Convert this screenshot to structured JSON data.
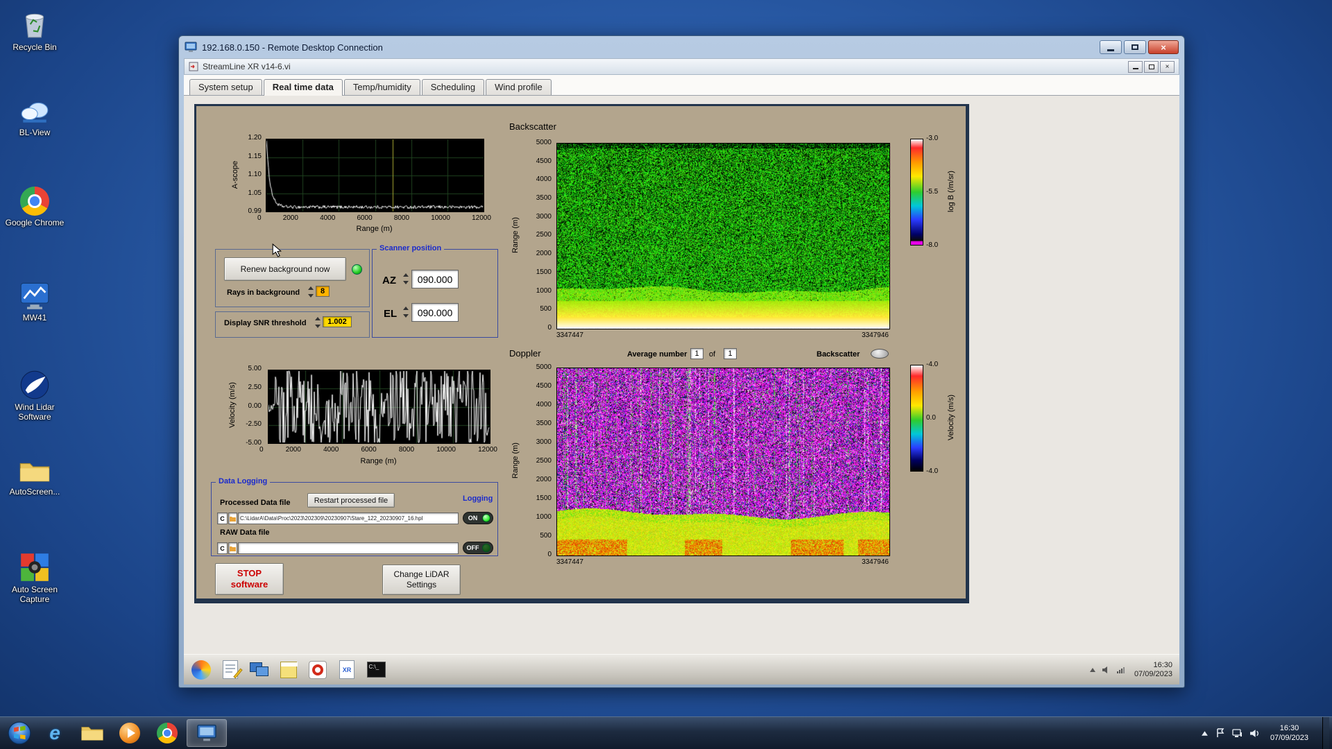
{
  "desktop": {
    "icons": [
      {
        "label": "Recycle Bin"
      },
      {
        "label": "BL-View"
      },
      {
        "label": "Google Chrome"
      },
      {
        "label": "MW41"
      },
      {
        "label": "Wind Lidar Software"
      },
      {
        "label": "AutoScreen..."
      },
      {
        "label": "Auto Screen Capture"
      }
    ]
  },
  "rdp": {
    "title": "192.168.0.150 - Remote Desktop Connection"
  },
  "vi": {
    "title": "StreamLine XR v14-6.vi",
    "tabs": [
      {
        "label": "System setup",
        "active": false
      },
      {
        "label": "Real time data",
        "active": true
      },
      {
        "label": "Temp/humidity",
        "active": false
      },
      {
        "label": "Scheduling",
        "active": false
      },
      {
        "label": "Wind profile",
        "active": false
      }
    ]
  },
  "panel": {
    "background_controls": {
      "renew_button": "Renew background now",
      "rays_label": "Rays in background",
      "rays_value": "8",
      "snr_label": "Display SNR threshold",
      "snr_value": "1.002"
    },
    "scanner": {
      "title": "Scanner position",
      "az_label": "AZ",
      "az_value": "090.000",
      "el_label": "EL",
      "el_value": "090.000"
    },
    "doppler_header": {
      "average_label": "Average number",
      "average_value": "1",
      "of_label": "of",
      "average_total": "1",
      "backscatter_toggle_label": "Backscatter"
    },
    "data_logging": {
      "title": "Data Logging",
      "processed_label": "Processed Data file",
      "restart_button": "Restart processed file",
      "logging_label": "Logging",
      "processed_drive": "C",
      "processed_path": "C:\\LidarA\\Data\\Proc\\2023\\202309\\20230907\\Stare_122_20230907_16.hpl",
      "on_label": "ON",
      "raw_label": "RAW Data file",
      "raw_drive": "C",
      "raw_path": "",
      "off_label": "OFF"
    },
    "stop_button_line1": "STOP",
    "stop_button_line2": "software",
    "change_button_line1": "Change LiDAR",
    "change_button_line2": "Settings"
  },
  "remote_taskbar": {
    "time": "16:30",
    "date": "07/09/2023",
    "icons": [
      "browser",
      "notepad",
      "dual-display",
      "notes",
      "power",
      "xr-file",
      "command-prompt"
    ]
  },
  "taskbar": {
    "time": "16:30",
    "date": "07/09/2023",
    "icons": [
      "start",
      "internet-explorer",
      "file-explorer",
      "media-player",
      "chrome",
      "remote-desktop"
    ]
  },
  "chart_data": [
    {
      "id": "ascope",
      "type": "line",
      "ylabel": "A-scope",
      "xlabel": "Range (m)",
      "yticks": [
        "1.20",
        "1.15",
        "1.10",
        "1.05",
        "0.99"
      ],
      "xticks": [
        "0",
        "2000",
        "4000",
        "6000",
        "8000",
        "10000",
        "12000"
      ],
      "ylim": [
        0.99,
        1.2
      ],
      "xlim": [
        0,
        12000
      ],
      "bg": "#000000",
      "trace_color": "#ffffff",
      "grid": true,
      "cursor_x_fraction": 0.58,
      "series": [
        {
          "name": "a-scope-trace",
          "description": "white trace starting at 1.20 at range 0, decaying exponentially to a noisy floor of about 1.00 by range ~1500 m, flat noisy ~1.00 out to 12000 m"
        }
      ]
    },
    {
      "id": "backscatter",
      "type": "heatmap",
      "title": "Backscatter",
      "ylabel": "Range (m)",
      "ylim": [
        0,
        5000
      ],
      "yticks": [
        "5000",
        "4500",
        "4000",
        "3500",
        "3000",
        "2500",
        "2000",
        "1500",
        "1000",
        "500",
        "0"
      ],
      "x_start_label": "3347447",
      "x_end_label": "3347946",
      "colorbar": {
        "label": "log B (/m/sr)",
        "ticks": [
          "-3.0",
          "-5.5",
          "-8.0"
        ],
        "stops": [
          "#ffffff 0%",
          "#ff2a2a 8%",
          "#ff9a00 22%",
          "#ffe800 35%",
          "#2ecc2e 50%",
          "#00c8d8 63%",
          "#2b3cff 76%",
          "#000066 90%",
          "#0a0a0a 96%",
          "#e800e8 97%",
          "#e800e8 100%"
        ]
      },
      "description": "speckled green noise (low backscatter) above ~1000 m with black speckle; bright solid green 800-1100 m; strong yellow-to-white backscatter layer below ~800 m down to range 0"
    },
    {
      "id": "velocity",
      "type": "line",
      "ylabel": "Velocity (m/s)",
      "xlabel": "Range (m)",
      "yticks": [
        "5.00",
        "2.50",
        "0.00",
        "-2.50",
        "-5.00"
      ],
      "xticks": [
        "0",
        "2000",
        "4000",
        "6000",
        "8000",
        "10000",
        "12000"
      ],
      "ylim": [
        -5,
        5
      ],
      "xlim": [
        0,
        12000
      ],
      "bg": "#000000",
      "trace_color": "#ffffff",
      "grid": true,
      "series": [
        {
          "name": "velocity-trace",
          "description": "small fluctuations near 0 m/s below ~400 m range, then dense white noise spikes saturating at +/-5 m/s out to 12000 m"
        }
      ]
    },
    {
      "id": "doppler",
      "type": "heatmap",
      "title": "Doppler",
      "ylabel": "Range (m)",
      "ylim": [
        0,
        5000
      ],
      "yticks": [
        "5000",
        "4500",
        "4000",
        "3500",
        "3000",
        "2500",
        "2000",
        "1500",
        "1000",
        "500",
        "0"
      ],
      "x_start_label": "3347447",
      "x_end_label": "3347946",
      "colorbar": {
        "label": "Velocity (m/s)",
        "ticks": [
          "-4.0",
          "0.0",
          "-4.0"
        ],
        "stops": [
          "#ffffff 0%",
          "#ff2a2a 10%",
          "#ffa000 25%",
          "#ffe800 38%",
          "#2ecc2e 52%",
          "#00c8d8 65%",
          "#2b3cff 78%",
          "#000060 90%",
          "#000000 100%"
        ]
      },
      "description": "magenta/purple random-velocity noise with blue/black speckle and vertical green/white streaks above ~1100 m; coherent yellow-green band (velocity near 0) with orange-red patches below ~450 m"
    }
  ]
}
